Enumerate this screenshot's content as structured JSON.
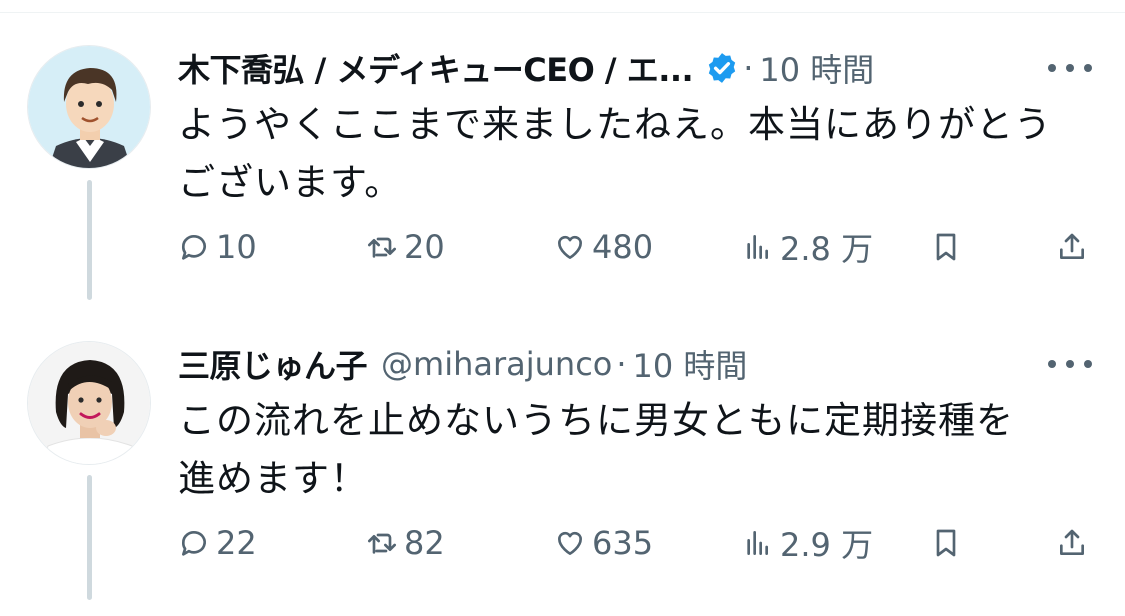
{
  "tweets": [
    {
      "display_name": "木下喬弘 / メディキューCEO / エ...",
      "verified": true,
      "handle": "",
      "separator": "·",
      "time": "10 時間",
      "text_line1": "ようやくここまで来ましたねえ。本当にありがとう",
      "text_line2": "ございます。",
      "replies": "10",
      "retweets": "20",
      "likes": "480",
      "views": "2.8 万"
    },
    {
      "display_name": "三原じゅん子",
      "verified": false,
      "handle": "@miharajunco",
      "separator": "·",
      "time": "10 時間",
      "text_line1": "この流れを止めないうちに男女ともに定期接種を",
      "text_line2": "進めます！",
      "replies": "22",
      "retweets": "82",
      "likes": "635",
      "views": "2.9 万"
    }
  ],
  "icons": {
    "verified": "verified-badge-icon",
    "more": "more-options-icon",
    "reply": "reply-icon",
    "retweet": "retweet-icon",
    "like": "heart-icon",
    "views": "views-icon",
    "bookmark": "bookmark-icon",
    "share": "share-icon"
  },
  "colors": {
    "text": "#0f1419",
    "secondary": "#536471",
    "verified": "#1d9bf0",
    "thread_line": "#cfd9de"
  }
}
